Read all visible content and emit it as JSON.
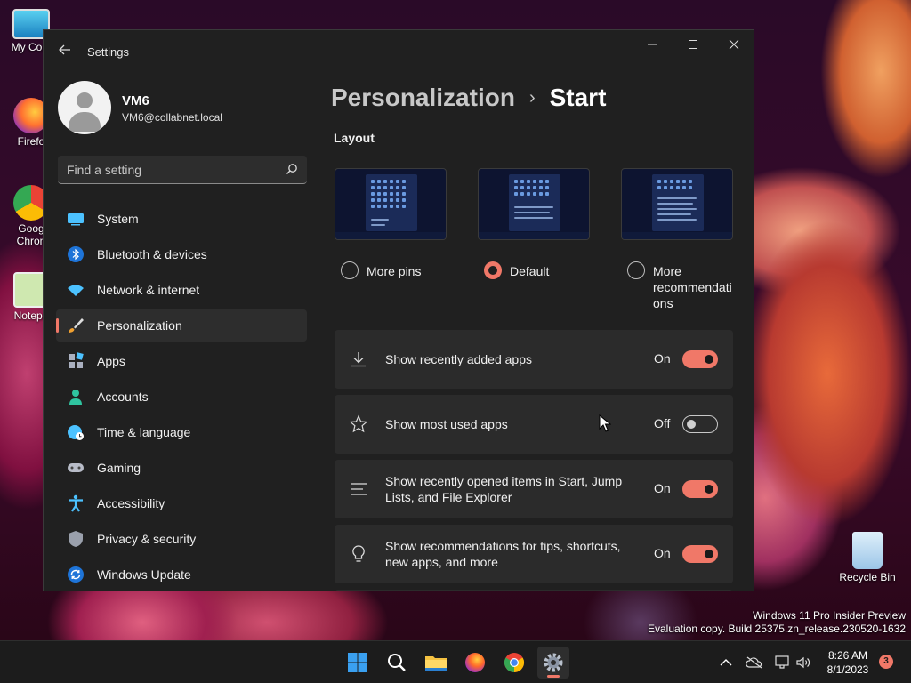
{
  "desktop": {
    "icons": [
      {
        "label": "My Com"
      },
      {
        "label": "Firefo"
      },
      {
        "label": "Goog Chron"
      },
      {
        "label": "Notepa"
      }
    ],
    "recycle_bin": {
      "label": "Recycle Bin"
    },
    "watermark": {
      "line1": "Windows 11 Pro Insider Preview",
      "line2": "Evaluation copy. Build 25375.zn_release.230520-1632"
    }
  },
  "window": {
    "title": "Settings",
    "user": {
      "name": "VM6",
      "email": "VM6@collabnet.local"
    },
    "search": {
      "placeholder": "Find a setting"
    },
    "nav": [
      {
        "label": "System",
        "icon": "monitor-icon"
      },
      {
        "label": "Bluetooth & devices",
        "icon": "bluetooth-icon"
      },
      {
        "label": "Network & internet",
        "icon": "wifi-icon"
      },
      {
        "label": "Personalization",
        "icon": "paintbrush-icon",
        "selected": true
      },
      {
        "label": "Apps",
        "icon": "apps-icon"
      },
      {
        "label": "Accounts",
        "icon": "person-icon"
      },
      {
        "label": "Time & language",
        "icon": "globe-clock-icon"
      },
      {
        "label": "Gaming",
        "icon": "gamepad-icon"
      },
      {
        "label": "Accessibility",
        "icon": "accessibility-icon"
      },
      {
        "label": "Privacy & security",
        "icon": "shield-icon"
      },
      {
        "label": "Windows Update",
        "icon": "update-icon"
      }
    ],
    "breadcrumb": {
      "parent": "Personalization",
      "separator": "›",
      "current": "Start"
    },
    "layout": {
      "label": "Layout",
      "options": [
        {
          "label": "More pins",
          "checked": false
        },
        {
          "label": "Default",
          "checked": true
        },
        {
          "label_lines": [
            "More",
            "recommendati",
            "ons"
          ],
          "checked": false
        }
      ]
    },
    "settings": [
      {
        "text": "Show recently added apps",
        "state": "On",
        "on": true,
        "icon": "download-icon"
      },
      {
        "text": "Show most used apps",
        "state": "Off",
        "on": false,
        "icon": "star-icon"
      },
      {
        "text": "Show recently opened items in Start, Jump Lists, and File Explorer",
        "state": "On",
        "on": true,
        "icon": "list-icon"
      },
      {
        "text": "Show recommendations for tips, shortcuts, new apps, and more",
        "state": "On",
        "on": true,
        "icon": "lightbulb-icon"
      }
    ]
  },
  "taskbar": {
    "clock": {
      "time": "8:26 AM",
      "date": "8/1/2023"
    },
    "notifications": "3"
  },
  "colors": {
    "accent": "#f07868",
    "window_bg": "#202020",
    "card_bg": "#2b2b2b"
  }
}
